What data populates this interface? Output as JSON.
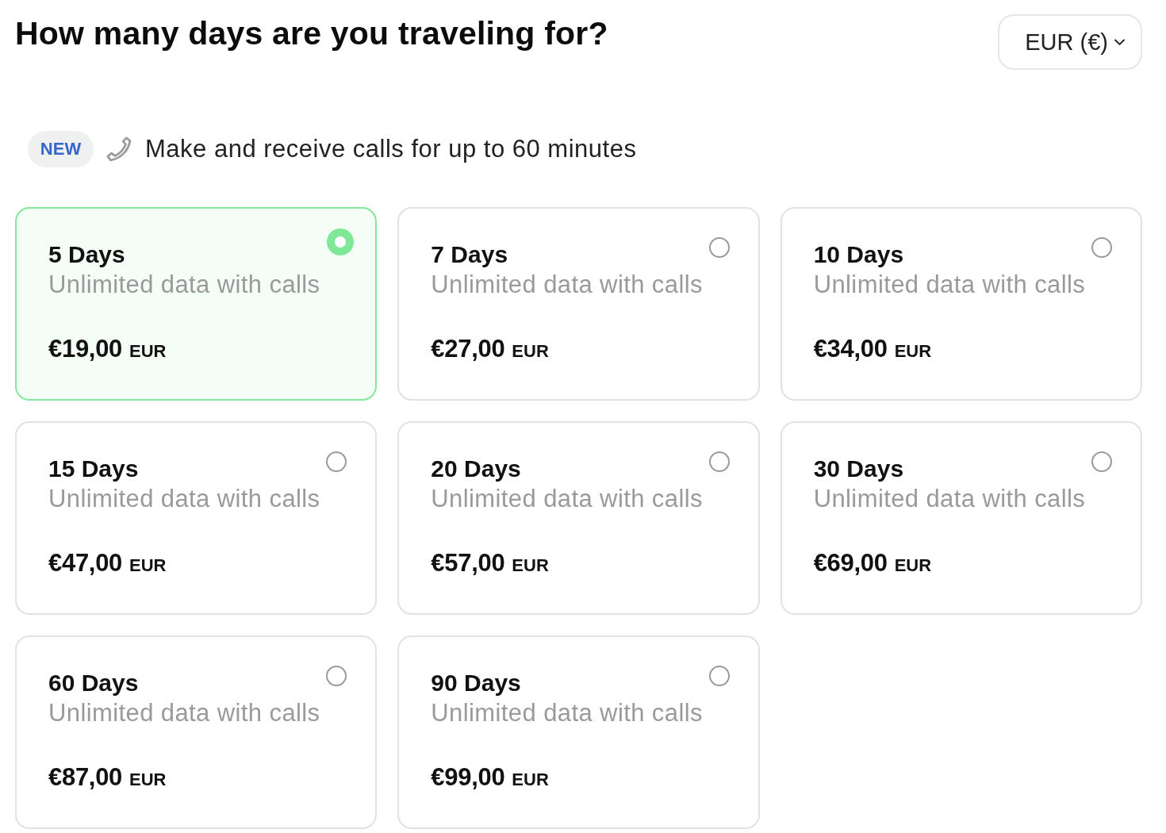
{
  "header": {
    "title": "How many days are you traveling for?",
    "currency_selector": {
      "label": "EUR (€)"
    }
  },
  "announcement": {
    "badge": "NEW",
    "text": "Make and receive calls for up to 60 minutes"
  },
  "plans": [
    {
      "title": "5 Days",
      "description": "Unlimited data with calls",
      "price": "€19,00",
      "currency": "EUR",
      "selected": true
    },
    {
      "title": "7 Days",
      "description": "Unlimited data with calls",
      "price": "€27,00",
      "currency": "EUR",
      "selected": false
    },
    {
      "title": "10 Days",
      "description": "Unlimited data with calls",
      "price": "€34,00",
      "currency": "EUR",
      "selected": false
    },
    {
      "title": "15 Days",
      "description": "Unlimited data with calls",
      "price": "€47,00",
      "currency": "EUR",
      "selected": false
    },
    {
      "title": "20 Days",
      "description": "Unlimited data with calls",
      "price": "€57,00",
      "currency": "EUR",
      "selected": false
    },
    {
      "title": "30 Days",
      "description": "Unlimited data with calls",
      "price": "€69,00",
      "currency": "EUR",
      "selected": false
    },
    {
      "title": "60 Days",
      "description": "Unlimited data with calls",
      "price": "€87,00",
      "currency": "EUR",
      "selected": false
    },
    {
      "title": "90 Days",
      "description": "Unlimited data with calls",
      "price": "€99,00",
      "currency": "EUR",
      "selected": false
    }
  ]
}
